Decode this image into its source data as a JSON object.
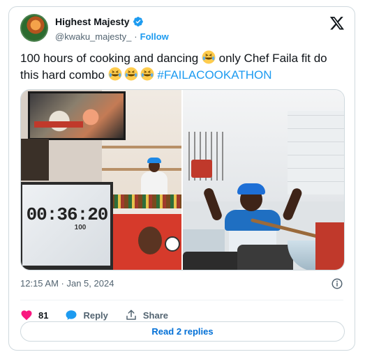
{
  "author": {
    "display_name": "Highest Majesty",
    "handle": "@kwaku_majesty_",
    "separator": "·",
    "follow_label": "Follow",
    "verified": true
  },
  "tweet": {
    "text_part1": "100 hours of cooking and dancing ",
    "text_part2": " only Chef Faila fit do this hard combo ",
    "hashtag": "#FAILACOOKATHON",
    "emoji_name": "face-with-tears-of-joy"
  },
  "media": {
    "left_photo": {
      "timer_text": "00:36:20",
      "timer_subtext": "100"
    },
    "right_photo": {}
  },
  "meta": {
    "timestamp": "12:15 AM · Jan 5, 2024"
  },
  "actions": {
    "like_count": "81",
    "reply_label": "Reply",
    "share_label": "Share"
  },
  "read_replies_label": "Read 2 replies",
  "colors": {
    "accent": "#1d9bf0",
    "like": "#f91880",
    "text_primary": "#0f1419",
    "text_secondary": "#536471",
    "border": "#cfd9de"
  }
}
